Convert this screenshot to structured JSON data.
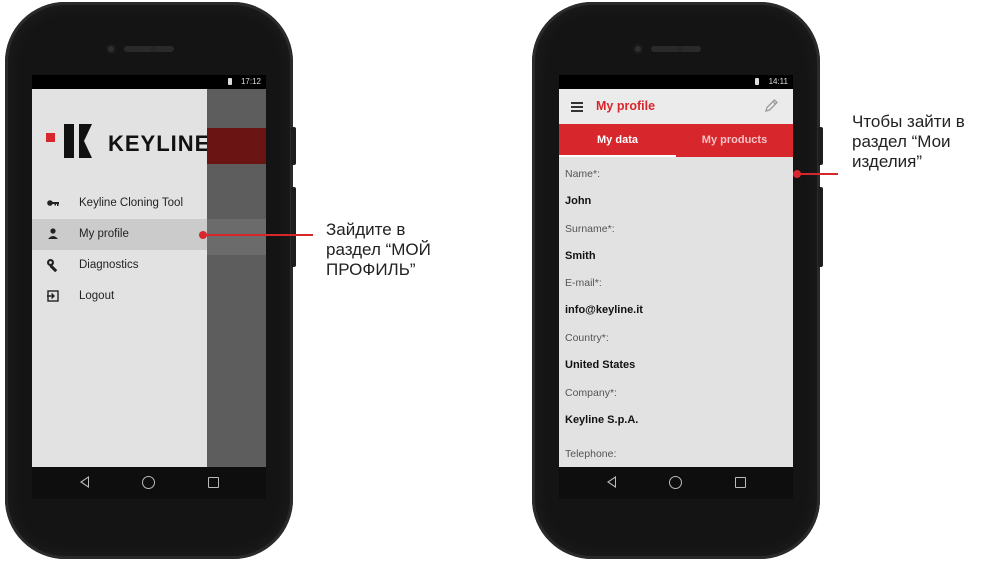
{
  "left_phone": {
    "status_time": "17:12",
    "logo_text": "KEYLINE",
    "menu": [
      {
        "label": "Keyline Cloning Tool",
        "icon": "key-icon"
      },
      {
        "label": "My profile",
        "icon": "person-icon",
        "active": true
      },
      {
        "label": "Diagnostics",
        "icon": "wrench-icon"
      },
      {
        "label": "Logout",
        "icon": "logout-icon"
      }
    ],
    "callout": "Зайдите в\nраздел “МОЙ\nПРОФИЛЬ”"
  },
  "right_phone": {
    "status_time": "14:11",
    "title": "My profile",
    "tabs": [
      "My data",
      "My products"
    ],
    "fields": [
      {
        "label": "Name*:",
        "value": "John"
      },
      {
        "label": "Surname*:",
        "value": "Smith"
      },
      {
        "label": "E-mail*:",
        "value": "info@keyline.it"
      },
      {
        "label": "Country*:",
        "value": "United States"
      },
      {
        "label": "Company*:",
        "value": "Keyline S.p.A."
      },
      {
        "label": "Telephone:",
        "value": ""
      }
    ],
    "callout": "Чтобы зайти в\nраздел “Мои\nизделия”"
  },
  "colors": {
    "accent": "#d8262d"
  }
}
